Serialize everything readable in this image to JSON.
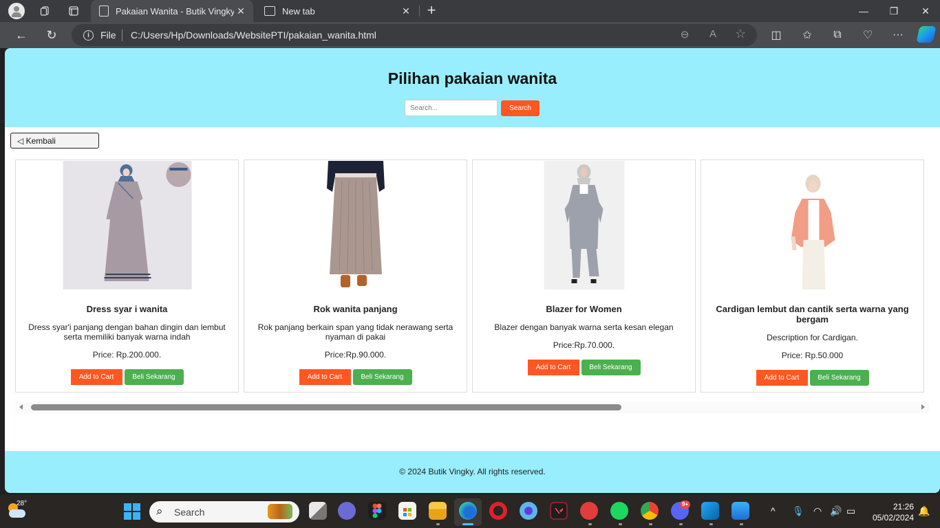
{
  "browser": {
    "tabs": [
      {
        "title": "Pakaian Wanita - Butik Vingky",
        "active": true,
        "close": "✕"
      },
      {
        "title": "New tab",
        "active": false,
        "close": "✕"
      }
    ],
    "new_tab": "+",
    "window_controls": {
      "minimize": "—",
      "restore": "❐",
      "close": "✕"
    },
    "nav": {
      "back": "←",
      "refresh": "↻"
    },
    "address": {
      "info": "i",
      "scheme_label": "File",
      "url": "C:/Users/Hp/Downloads/WebsitePTI/pakaian_wanita.html"
    },
    "addr_icons": {
      "zoom_out": "⊖",
      "read_aloud": "A",
      "favorite": "☆"
    },
    "toolbar_icons": {
      "split": "◫",
      "favorites": "✩",
      "collections": "⧉",
      "health": "♡",
      "more": "···"
    }
  },
  "page": {
    "title": "Pilihan pakaian wanita",
    "search": {
      "placeholder": "Search...",
      "value": "",
      "button": "Search"
    },
    "back_button": "◁ Kembali",
    "products": [
      {
        "name": "Dress syar i wanita",
        "description": "Dress syar'i panjang dengan bahan dingin dan lembut serta memiliki banyak warna indah",
        "price": "Price: Rp.200.000.",
        "add_to_cart": "Add to Cart",
        "buy_now": "Beli Sekarang",
        "image": "dress-photo"
      },
      {
        "name": "Rok wanita panjang",
        "description": "Rok panjang berkain span yang tidak nerawang serta nyaman di pakai",
        "price": "Price:Rp.90.000.",
        "add_to_cart": "Add to Cart",
        "buy_now": "Beli Sekarang",
        "image": "skirt-photo"
      },
      {
        "name": "Blazer for Women",
        "description": "Blazer dengan banyak warna serta kesan elegan",
        "price": "Price:Rp.70.000.",
        "add_to_cart": "Add to Cart",
        "buy_now": "Beli Sekarang",
        "image": "blazer-photo"
      },
      {
        "name": "Cardigan lembut dan cantik serta warna yang bergam",
        "description": "Description for Cardigan.",
        "price": "Price: Rp.50.000",
        "add_to_cart": "Add to Cart",
        "buy_now": "Beli Sekarang",
        "image": "cardigan-photo"
      }
    ],
    "scroll_position": 0,
    "footer": "© 2024 Butik Vingky. All rights reserved.",
    "colors": {
      "header_bg": "#98eefc",
      "accent_orange": "#ff5722",
      "accent_green": "#4caf50"
    }
  },
  "taskbar": {
    "weather_temp": "28°",
    "search_label": "Search",
    "search_icon": "⌕",
    "apps": [
      "task-view",
      "teams-chat",
      "figma",
      "microsoft-store",
      "file-explorer",
      "edge",
      "opera",
      "app-circle",
      "valorant",
      "wps-office",
      "spotify",
      "chrome",
      "discord",
      "vscode",
      "photos"
    ],
    "discord_badge": "9+",
    "tray": {
      "chevron": "^",
      "mic": "🎙",
      "wifi": "◠",
      "volume": "🔊",
      "battery": "▭"
    },
    "time": "21:26",
    "date": "05/02/2024",
    "notifications": "🔔"
  }
}
